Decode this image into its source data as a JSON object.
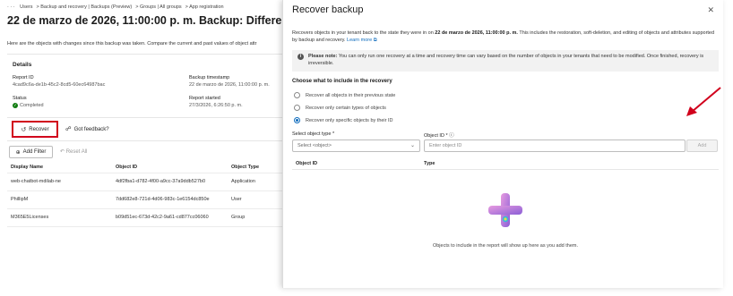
{
  "breadcrumb": [
    "· · ·",
    "Users",
    "Backup and recovery | Backups (Preview)",
    "Groups | All groups",
    "App registration"
  ],
  "page": {
    "title": "22 de marzo de 2026, 11:00:00 p. m. Backup: Difference Report",
    "intro": "Here are the objects with changes since this backup was taken. Compare the current and past values of object attr"
  },
  "details": {
    "title": "Details",
    "report_id_label": "Report ID",
    "report_id": "4cad9c6a-de1b-45c2-8cd5-60ec64987bac",
    "backup_ts_label": "Backup timestamp",
    "backup_ts": "22 de marzo de 2026, 11:00:00 p. m.",
    "status_label": "Status",
    "status": "Completed",
    "report_started_label": "Report started",
    "report_started": "27/3/2026, 6:26:50 p. m."
  },
  "toolbar": {
    "recover": "Recover",
    "feedback": "Got feedback?"
  },
  "filters": {
    "add": "Add Filter",
    "reset": "Reset All"
  },
  "table": {
    "headers": [
      "Display Name",
      "Object ID",
      "Object Type"
    ],
    "rows": [
      [
        "web-chatbot-mdilab-ne",
        "4df2fba1-d782-4f00-a9cc-37a9ddb527b0",
        "Application"
      ],
      [
        "PhillipM",
        "7dd682e8-721d-4d06-983c-1e6154dc850e",
        "User"
      ],
      [
        "M365E5Licenses",
        "b09d51ec-673d-42c2-9a61-cd877cc06060",
        "Group"
      ]
    ]
  },
  "panel": {
    "title": "Recover backup",
    "intro_pre": "Recovers objects in your tenant back to the state they were in on ",
    "intro_date": "22 de marzo de 2026, 11:00:00 p. m.",
    "intro_post": " This includes the restoration, soft-deletion, and editing of objects and attributes supported by backup and recovery. ",
    "learn_more": "Learn more",
    "note_bold": "Please note:",
    "note_text": " You can only run one recovery at a time and recovery time can vary based on the number of objects in your tenants that need to be modified. Once finished, recovery is irreversible.",
    "section_title": "Choose what to include in the recovery",
    "options": [
      "Recover all objects in their previous state",
      "Recover only certain types of objects",
      "Recover only specific objects by their ID"
    ],
    "selected_option": 2,
    "object_type_label": "Select object type *",
    "object_type_value": "Select <object>",
    "object_id_label": "Object ID * ⓘ",
    "object_id_placeholder": "Enter object ID",
    "add_button": "Add",
    "col_object_id": "Object ID",
    "col_type": "Type",
    "empty_message": "Objects to include in the report will show up here as you add them."
  },
  "colors": {
    "accent": "#0f6cbd",
    "highlight": "#d1001c",
    "success": "#107c10"
  },
  "icons": [
    "recover-icon",
    "feedback-icon",
    "add-filter-icon",
    "reset-icon",
    "close-icon",
    "info-icon",
    "chevron-down-icon",
    "empty-state-illustration"
  ]
}
